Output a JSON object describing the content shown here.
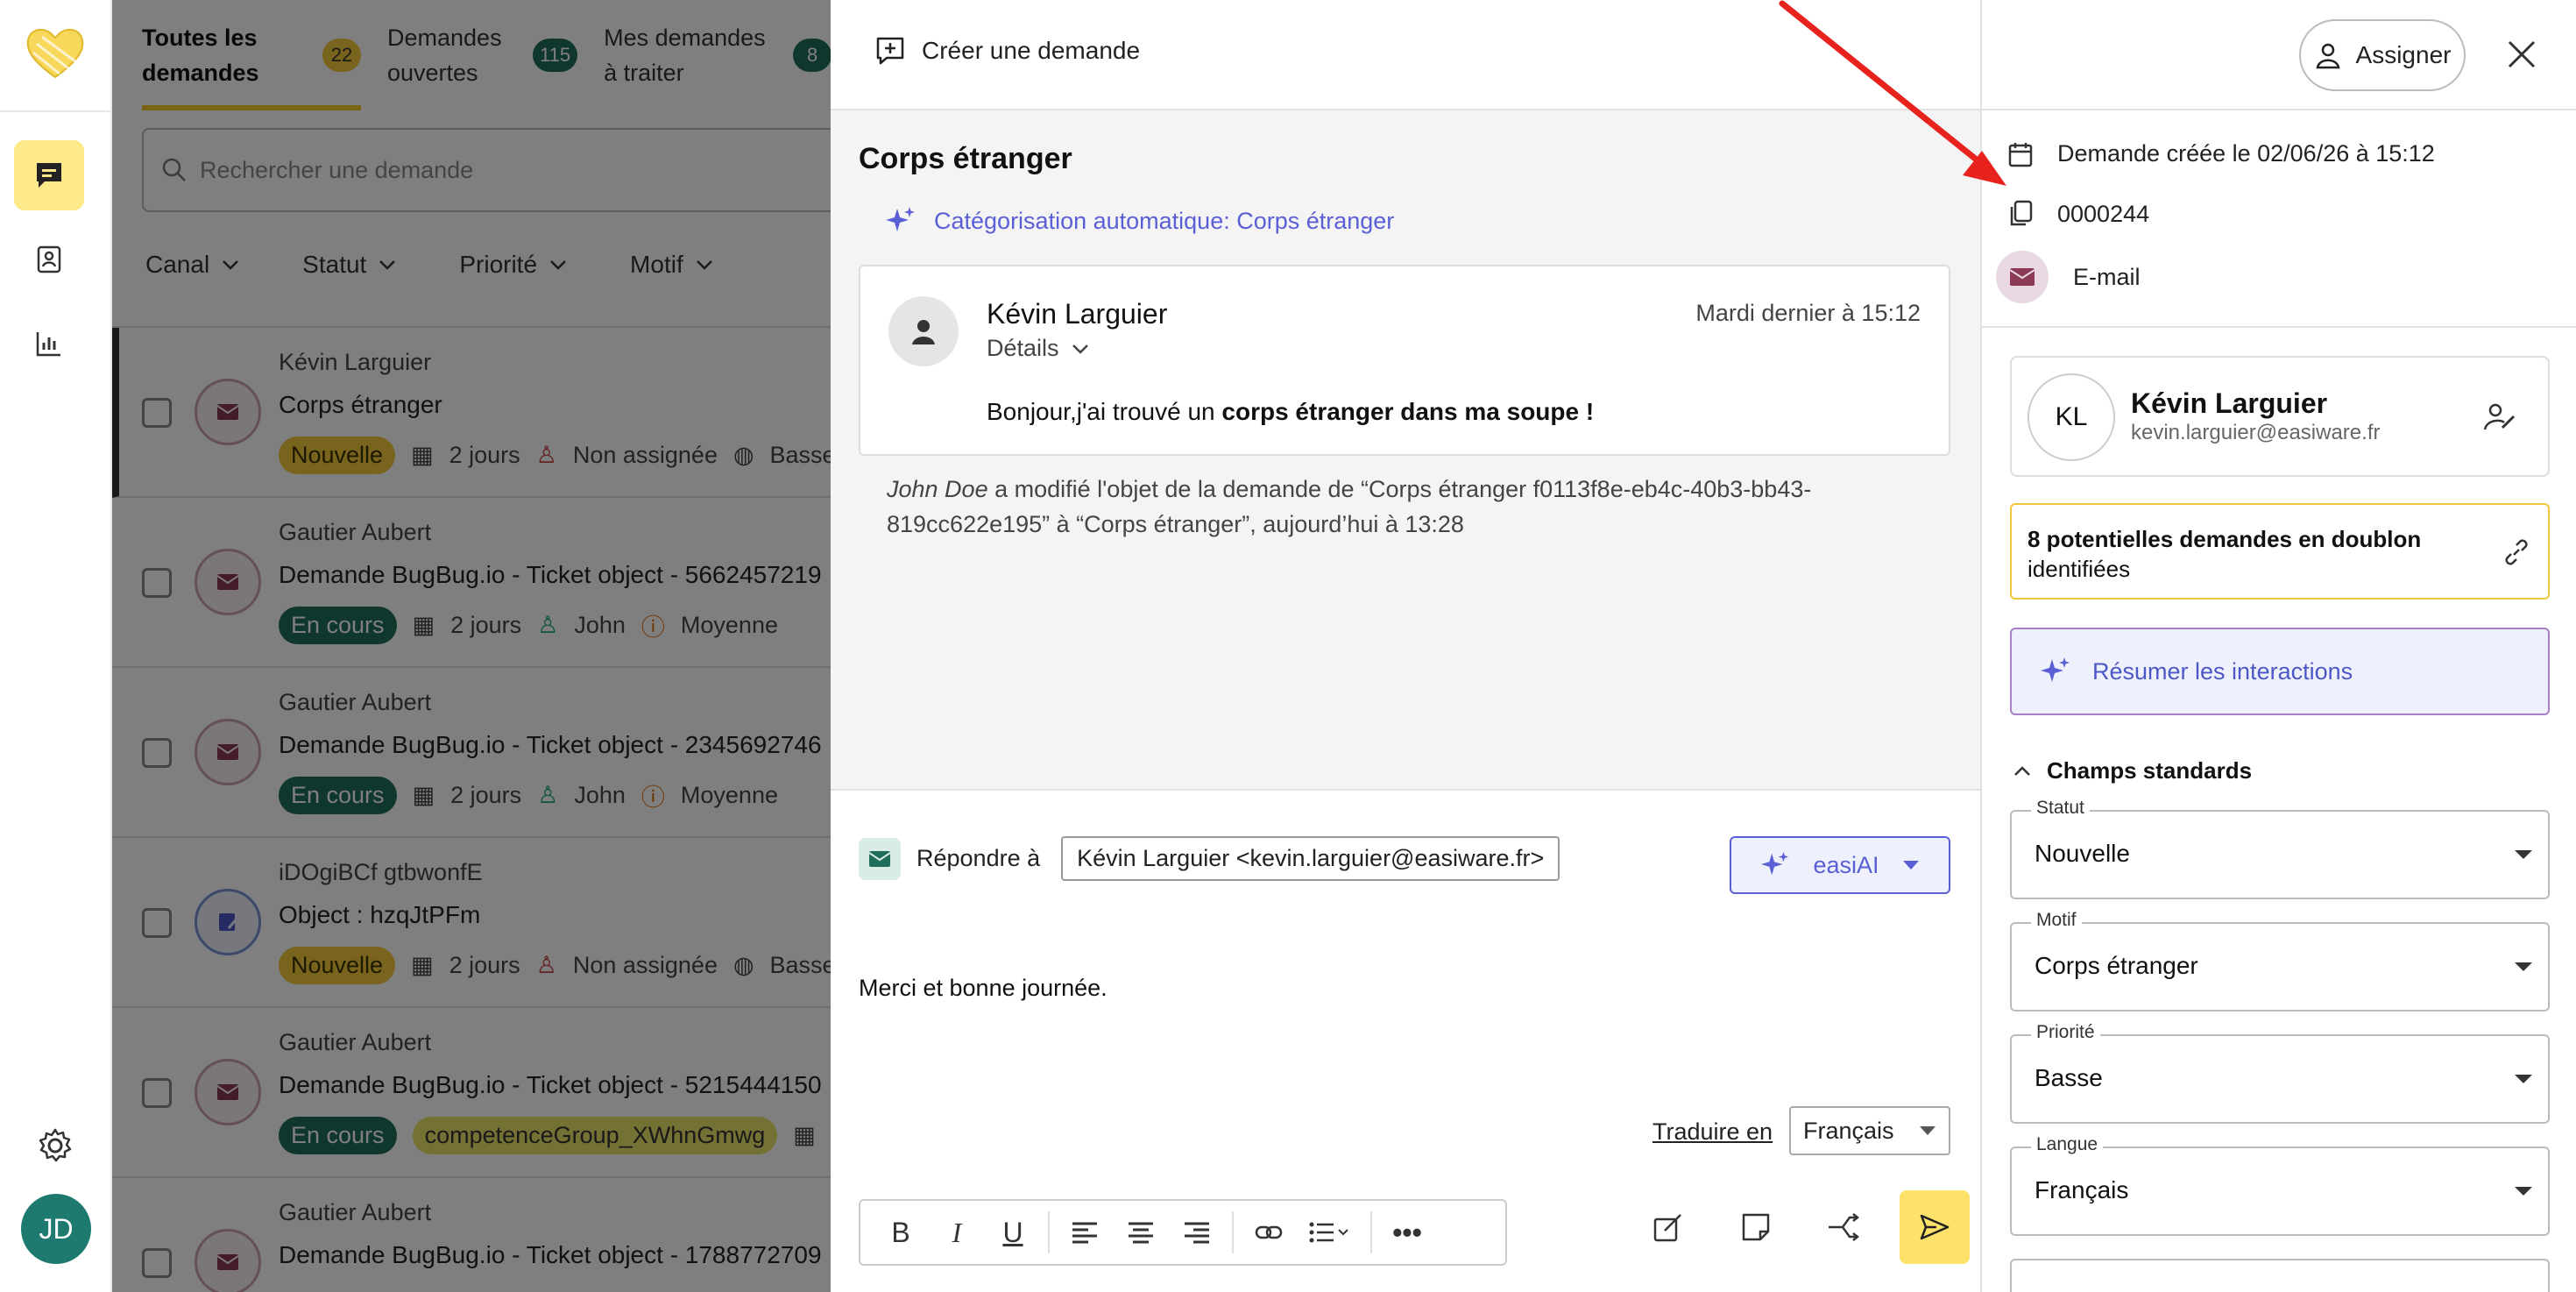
{
  "nav": {
    "avatar_initials": "JD",
    "icons": [
      "logo-heart-icon",
      "chat-icon",
      "contacts-icon",
      "chart-icon",
      "gear-icon"
    ]
  },
  "list": {
    "tabs": [
      {
        "label": "Toutes les demandes",
        "count": "22"
      },
      {
        "label": "Demandes ouvertes",
        "count": "115"
      },
      {
        "label": "Mes demandes à traiter",
        "count": "8"
      }
    ],
    "search_placeholder": "Rechercher une demande",
    "filters": [
      "Canal",
      "Statut",
      "Priorité",
      "Motif"
    ],
    "rows": [
      {
        "name": "Kévin Larguier",
        "subject": "Corps étranger",
        "status": "Nouvelle",
        "age": "2 jours",
        "assignee": "Non assignée",
        "priority": "Basse"
      },
      {
        "name": "Gautier Aubert",
        "subject": "Demande BugBug.io - Ticket object - 5662457219",
        "status": "En cours",
        "age": "2 jours",
        "assignee": "John",
        "priority": "Moyenne"
      },
      {
        "name": "Gautier Aubert",
        "subject": "Demande BugBug.io - Ticket object - 2345692746",
        "status": "En cours",
        "age": "2 jours",
        "assignee": "John",
        "priority": "Moyenne"
      },
      {
        "name": "iDOgiBCf gtbwonfE",
        "subject": "Object : hzqJtPFm",
        "status": "Nouvelle",
        "age": "2 jours",
        "assignee": "Non assignée",
        "priority": "Basse"
      },
      {
        "name": "Gautier Aubert",
        "subject": "Demande BugBug.io - Ticket object - 5215444150",
        "status": "En cours",
        "group": "competenceGroup_XWhnGmwg"
      },
      {
        "name": "Gautier Aubert",
        "subject": "Demande BugBug.io - Ticket object - 1788772709"
      }
    ]
  },
  "ticket": {
    "create_label": "Créer une demande",
    "title": "Corps étranger",
    "auto_category": "Catégorisation automatique: Corps étranger",
    "message": {
      "from": "Kévin Larguier",
      "details_label": "Détails",
      "when": "Mardi dernier à 15:12",
      "body_prefix": "Bonjour,j'ai trouvé un ",
      "body_bold": "corps étranger dans ma soupe !"
    },
    "log": {
      "actor": "John Doe",
      "text": " a modifié l'objet de la demande de “Corps étranger f0113f8e-eb4c-40b3-bb43-819cc622e195” à “Corps étranger”, aujourd’hui à 13:28"
    },
    "reply": {
      "reply_to_label": "Répondre à",
      "reply_to_value": "Kévin Larguier <kevin.larguier@easiware.fr>",
      "ai_label": "easiAI",
      "text": "Merci et bonne journée.",
      "translate_label": "Traduire en",
      "language": "Français"
    }
  },
  "side": {
    "assign_label": "Assigner",
    "created": "Demande créée le 02/06/26 à 15:12",
    "id": "0000244",
    "channel": "E-mail",
    "contact": {
      "initials": "KL",
      "name": "Kévin Larguier",
      "email": "kevin.larguier@easiware.fr"
    },
    "duplicates_bold": "8 potentielles demandes en doublon",
    "duplicates_rest": "identifiées",
    "summarize_label": "Résumer les interactions",
    "section_label": "Champs standards",
    "fields": [
      {
        "label": "Statut",
        "value": "Nouvelle"
      },
      {
        "label": "Motif",
        "value": "Corps étranger"
      },
      {
        "label": "Priorité",
        "value": "Basse"
      },
      {
        "label": "Langue",
        "value": "Français"
      }
    ]
  },
  "colors": {
    "accent_yellow": "#fde26a",
    "ai_purple": "#5b5fd6",
    "status_green": "#1f6e5b",
    "annotation_red": "#e8231d"
  }
}
